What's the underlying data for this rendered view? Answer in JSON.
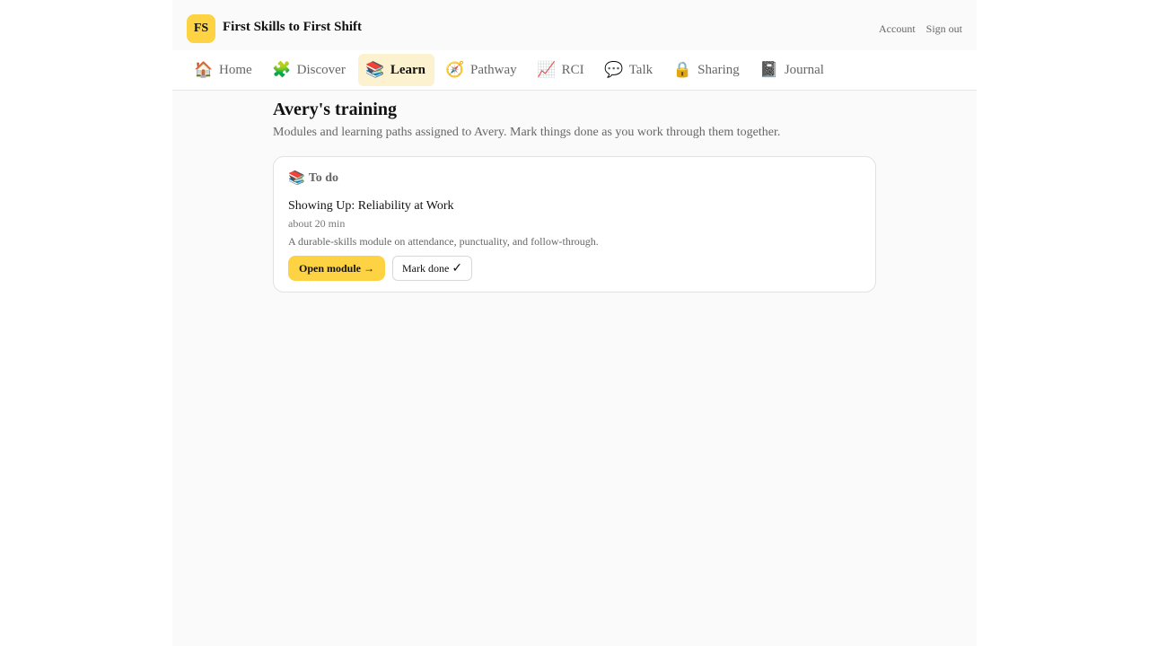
{
  "header": {
    "logo_text": "FS",
    "app_title": "First Skills to First Shift",
    "account_label": "Account",
    "signout_label": "Sign out"
  },
  "nav": {
    "items": [
      {
        "icon": "🏠",
        "icon_name": "home-icon",
        "label": "Home"
      },
      {
        "icon": "🧩",
        "icon_name": "puzzle-icon",
        "label": "Discover"
      },
      {
        "icon": "📚",
        "icon_name": "books-icon",
        "label": "Learn",
        "active": true
      },
      {
        "icon": "🧭",
        "icon_name": "compass-icon",
        "label": "Pathway"
      },
      {
        "icon": "📈",
        "icon_name": "chart-icon",
        "label": "RCI"
      },
      {
        "icon": "💬",
        "icon_name": "speech-bubble-icon",
        "label": "Talk"
      },
      {
        "icon": "🔒",
        "icon_name": "lock-icon",
        "label": "Sharing"
      },
      {
        "icon": "📓",
        "icon_name": "notebook-icon",
        "label": "Journal"
      }
    ]
  },
  "main": {
    "title": "Avery's training",
    "subtitle": "Modules and learning paths assigned to Avery. Mark things done as you work through them together.",
    "todo": {
      "icon": "📚",
      "heading": "To do",
      "module": {
        "title": "Showing Up: Reliability at Work",
        "duration": "about 20 min",
        "description": "A durable-skills module on attendance, punctuality, and follow-through.",
        "open_label": "Open module →",
        "done_label": "Mark done",
        "done_check": "✓"
      }
    }
  },
  "colors": {
    "accent": "#fdd243",
    "active_tab_bg": "#fdf2cf",
    "page_bg": "#fafafa"
  }
}
